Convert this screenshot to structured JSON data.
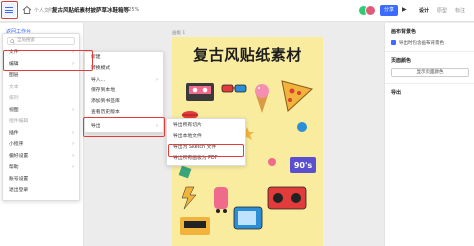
{
  "topbar": {
    "breadcrumb_sep": "/",
    "breadcrumb_root": "个人文件",
    "title": "复古风贴纸素材披萨草冰鞋箱等",
    "zoom": "125%",
    "share_label": "分享",
    "play_label": "▶",
    "tabs": {
      "design": "设计",
      "prototype": "原型",
      "annotate": "标注"
    }
  },
  "leftpanel": {
    "back_label": "返回工作台"
  },
  "main_menu": {
    "search_placeholder": "全局搜索",
    "items": [
      {
        "label": "文件",
        "arrow": "›"
      },
      {
        "label": "编辑",
        "arrow": "›"
      },
      {
        "label": "图层"
      },
      {
        "label": "文本"
      },
      {
        "label": "排列"
      },
      {
        "label": "视图",
        "arrow": "›"
      },
      {
        "label": "组件编辑"
      },
      {
        "label": "插件",
        "arrow": "›"
      },
      {
        "label": "小程序",
        "arrow": "›"
      },
      {
        "label": "偏好设置",
        "arrow": "›"
      },
      {
        "label": "帮助",
        "arrow": "›"
      },
      {
        "label": "账号设置"
      },
      {
        "label": "退出登录"
      }
    ]
  },
  "file_menu": {
    "items": [
      {
        "label": "新建"
      },
      {
        "label": "转换模式"
      },
      {
        "label": "导入...",
        "arrow": "›"
      },
      {
        "label": "保存到本地"
      },
      {
        "label": "添加到书签库"
      },
      {
        "label": "查看历史版本"
      },
      {
        "label": "导出",
        "arrow": "›"
      }
    ]
  },
  "export_menu": {
    "items": [
      {
        "label": "导出所有切片"
      },
      {
        "label": "导出本地文件"
      },
      {
        "label": "导出为 Sketch 文件"
      },
      {
        "label": "导出所有画板为 PDF"
      }
    ]
  },
  "canvas": {
    "artboard_label": "画板 1",
    "heading": "复古风贴纸素材"
  },
  "rightpanel": {
    "bg_section": "画布背景色",
    "bg_checkbox": "导出时包含画布背景色",
    "page_section": "页面颜色",
    "page_button": "显示页面颜色",
    "export_section": "导出"
  },
  "colors": {
    "accent": "#3b6cff",
    "highlight": "#e23b3b",
    "artboard_bg": "#f9ec9f"
  }
}
